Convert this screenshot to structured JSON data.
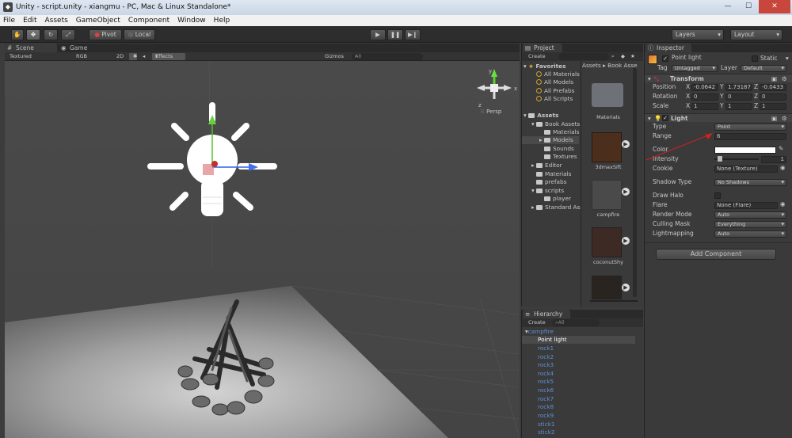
{
  "window": {
    "title": "Unity - script.unity - xiangmu - PC, Mac & Linux Standalone*",
    "min": "—",
    "max": "☐",
    "close": "✕"
  },
  "menu": [
    "File",
    "Edit",
    "Assets",
    "GameObject",
    "Component",
    "Window",
    "Help"
  ],
  "toolbar": {
    "pivot": "Pivot",
    "local": "Local",
    "layers": "Layers",
    "layout": "Layout"
  },
  "scene": {
    "tab_scene": "Scene",
    "tab_game": "Game",
    "shading": "Textured",
    "render_mode": "RGB",
    "mode_2d": "2D",
    "effects": "Effects",
    "gizmos": "Gizmos",
    "search": "All",
    "persp": "Persp",
    "gizmo_y": "y",
    "gizmo_x": "x",
    "gizmo_z": "z"
  },
  "project": {
    "tab": "Project",
    "create": "Create",
    "favorites_label": "Favorites",
    "favorites": [
      "All Materials",
      "All Models",
      "All Prefabs",
      "All Scripts"
    ],
    "assets_label": "Assets",
    "tree": [
      "Book Assets",
      "Materials",
      "Models",
      "Sounds",
      "Textures",
      "Editor",
      "Materials",
      "prefabs",
      "scripts",
      "player",
      "Standard Assets"
    ],
    "breadcrumb_assets": "Assets",
    "breadcrumb_folder": "Book Asse",
    "thumbs": [
      "Materials",
      "3dmaxSift",
      "campfire",
      "coconutShy"
    ]
  },
  "hierarchy": {
    "tab": "Hierarchy",
    "create": "Create",
    "search": "All",
    "root": "campfire",
    "items": [
      "Point light",
      "rock1",
      "rock2",
      "rock3",
      "rock4",
      "rock5",
      "rock6",
      "rock7",
      "rock8",
      "rock9",
      "stick1",
      "stick2"
    ]
  },
  "inspector": {
    "tab": "Inspector",
    "object_name": "Point light",
    "static": "Static",
    "tag_label": "Tag",
    "tag_value": "Untagged",
    "layer_label": "Layer",
    "layer_value": "Default",
    "transform": {
      "title": "Transform",
      "position_label": "Position",
      "rotation_label": "Rotation",
      "scale_label": "Scale",
      "x": "X",
      "y": "Y",
      "z": "Z",
      "position": [
        "-0.0642",
        "1.73187",
        "-0.0433"
      ],
      "rotation": [
        "0",
        "0",
        "0"
      ],
      "scale": [
        "1",
        "1",
        "1"
      ]
    },
    "light": {
      "title": "Light",
      "type_label": "Type",
      "type_value": "Point",
      "range_label": "Range",
      "range_value": "6",
      "color_label": "Color",
      "intensity_label": "Intensity",
      "intensity_value": "1",
      "cookie_label": "Cookie",
      "cookie_value": "None (Texture)",
      "shadow_label": "Shadow Type",
      "shadow_value": "No Shadows",
      "halo_label": "Draw Halo",
      "flare_label": "Flare",
      "flare_value": "None (Flare)",
      "render_label": "Render Mode",
      "render_value": "Auto",
      "culling_label": "Culling Mask",
      "culling_value": "Everything",
      "lightmap_label": "Lightmapping",
      "lightmap_value": "Auto"
    },
    "add_component": "Add Component"
  },
  "colors": {
    "hierarchy_item": "#5f8fd6",
    "annotation_arrow": "#d02020"
  }
}
